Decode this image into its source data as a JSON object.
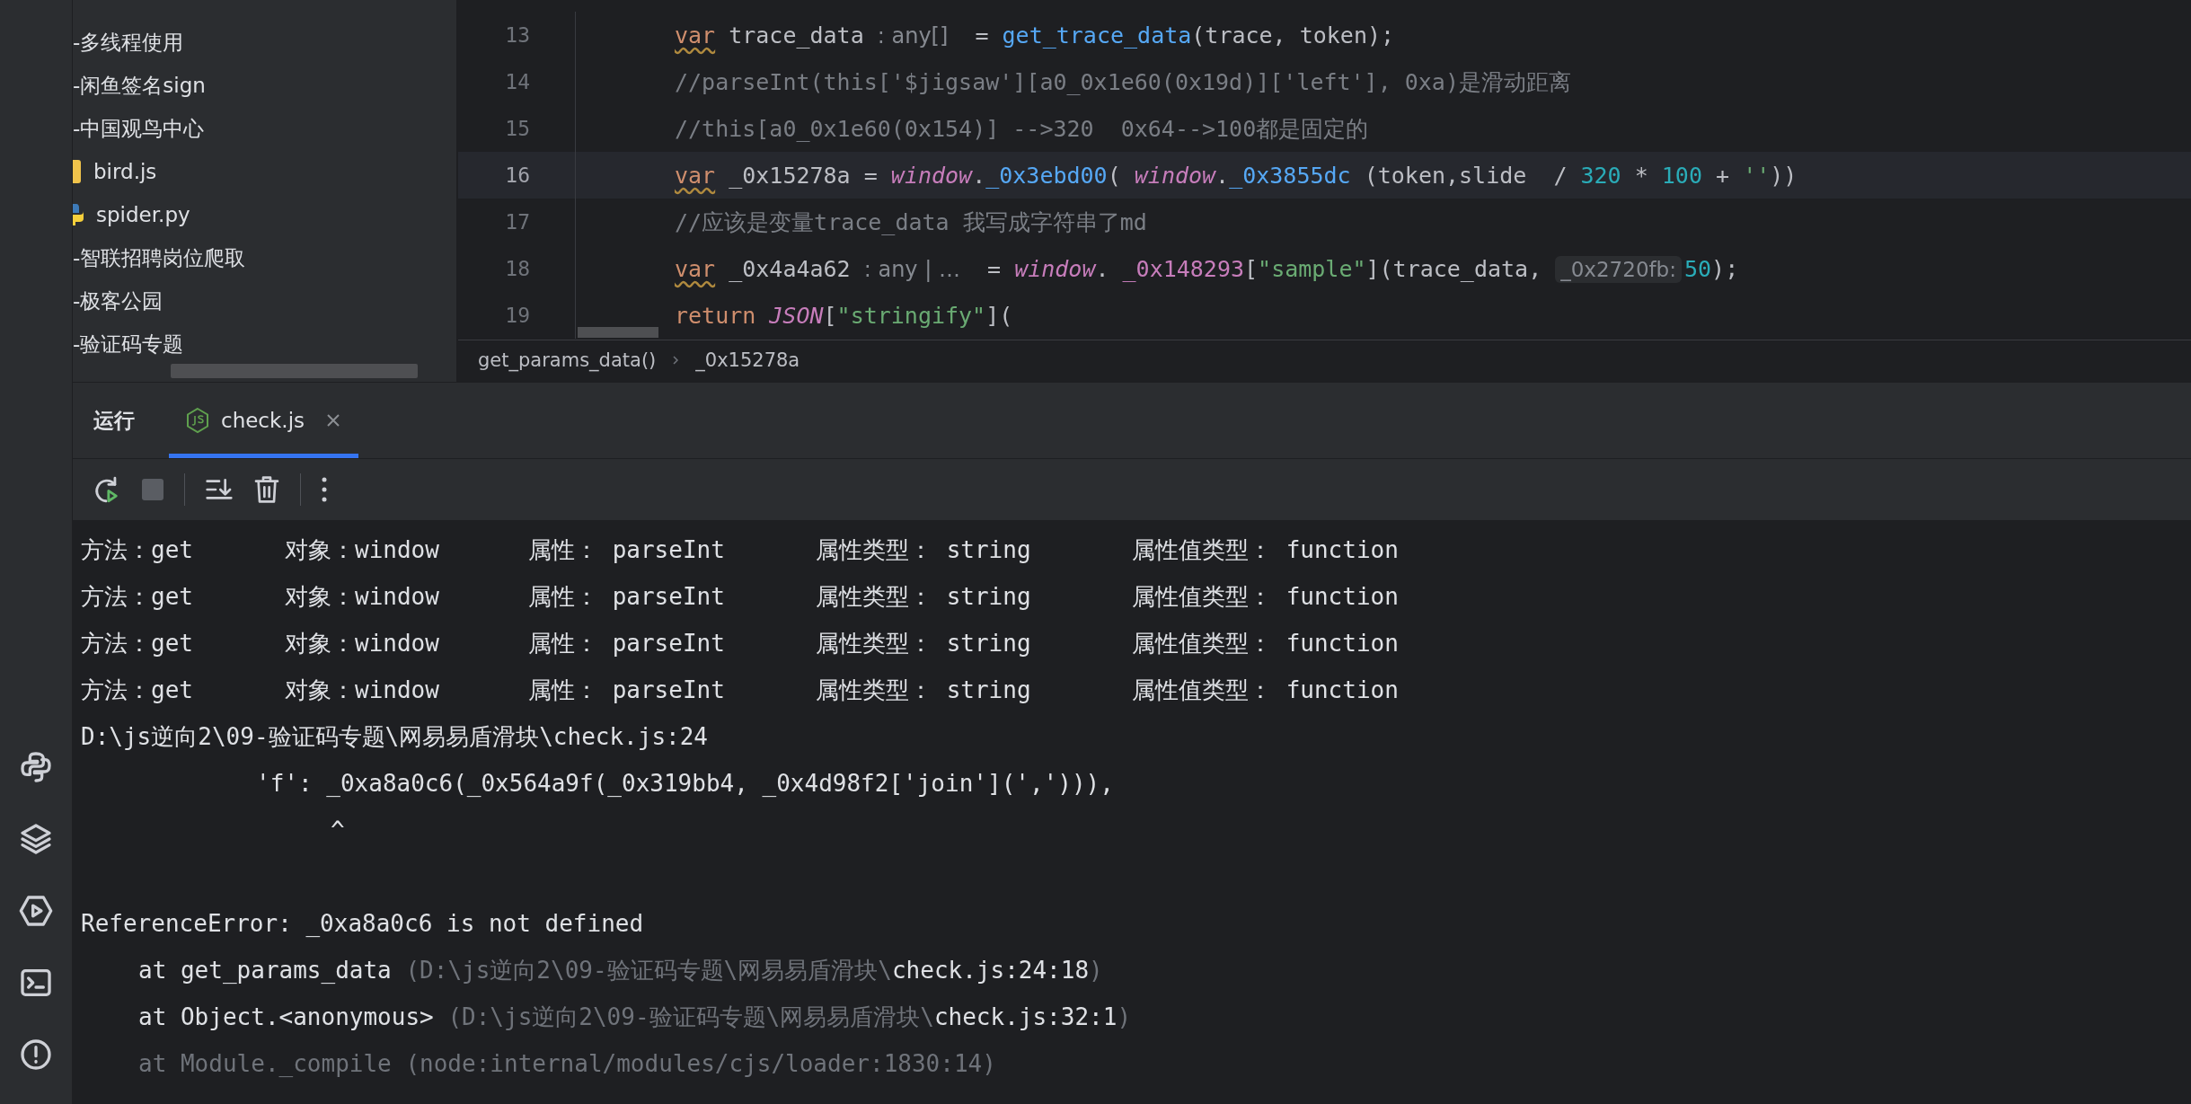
{
  "project_tree": {
    "items": [
      {
        "label": "-多线程使用",
        "kind": "folder"
      },
      {
        "label": "-闲鱼签名sign",
        "kind": "folder"
      },
      {
        "label": "-中国观鸟中心",
        "kind": "folder"
      },
      {
        "label": "bird.js",
        "kind": "js"
      },
      {
        "label": "spider.py",
        "kind": "python"
      },
      {
        "label": "-智联招聘岗位爬取",
        "kind": "folder"
      },
      {
        "label": "-极客公园",
        "kind": "folder"
      },
      {
        "label": "-验证码专题",
        "kind": "folder"
      }
    ]
  },
  "editor": {
    "lines": [
      {
        "number": "13",
        "current": false,
        "tokens": [
          {
            "text": "var",
            "kind": "keyword_warning"
          },
          {
            "text": " trace_data ",
            "kind": "plain"
          },
          {
            "text": ": any[]",
            "kind": "hint"
          },
          {
            "text": "  = ",
            "kind": "plain"
          },
          {
            "text": "get_trace_data",
            "kind": "function"
          },
          {
            "text": "(trace, token);",
            "kind": "plain"
          }
        ]
      },
      {
        "number": "14",
        "current": false,
        "tokens": [
          {
            "text": "//parseInt(this['$jigsaw'][a0_0x1e60(0x19d)]['left'], 0xa)是滑动距离",
            "kind": "comment"
          }
        ]
      },
      {
        "number": "15",
        "current": false,
        "tokens": [
          {
            "text": "//this[a0_0x1e60(0x154)] -->320  0x64-->100都是固定的",
            "kind": "comment"
          }
        ]
      },
      {
        "number": "16",
        "current": true,
        "tokens": [
          {
            "text": "var",
            "kind": "keyword_warning"
          },
          {
            "text": " _0x15278a = ",
            "kind": "plain"
          },
          {
            "text": "window",
            "kind": "global"
          },
          {
            "text": ".",
            "kind": "plain"
          },
          {
            "text": "_0x3ebd00",
            "kind": "function"
          },
          {
            "text": "( ",
            "kind": "plain"
          },
          {
            "text": "window",
            "kind": "global"
          },
          {
            "text": ".",
            "kind": "plain"
          },
          {
            "text": "_0x3855dc",
            "kind": "function"
          },
          {
            "text": " (token,slide  / ",
            "kind": "plain"
          },
          {
            "text": "320",
            "kind": "number"
          },
          {
            "text": " * ",
            "kind": "plain"
          },
          {
            "text": "100",
            "kind": "number"
          },
          {
            "text": " + ",
            "kind": "plain"
          },
          {
            "text": "''",
            "kind": "string"
          },
          {
            "text": "))",
            "kind": "plain"
          }
        ]
      },
      {
        "number": "17",
        "current": false,
        "tokens": [
          {
            "text": "//应该是变量trace_data 我写成字符串了md",
            "kind": "comment"
          }
        ]
      },
      {
        "number": "18",
        "current": false,
        "tokens": [
          {
            "text": "var",
            "kind": "keyword_warning"
          },
          {
            "text": " _0x4a4a62 ",
            "kind": "plain"
          },
          {
            "text": ": any | …",
            "kind": "hint"
          },
          {
            "text": "  = ",
            "kind": "plain"
          },
          {
            "text": "window",
            "kind": "global"
          },
          {
            "text": ". ",
            "kind": "plain"
          },
          {
            "text": "_0x148293",
            "kind": "property"
          },
          {
            "text": "[",
            "kind": "plain"
          },
          {
            "text": "\"sample\"",
            "kind": "string"
          },
          {
            "text": "](trace_data, ",
            "kind": "plain"
          },
          {
            "text": "_0x2720fb:",
            "kind": "parameter_hint"
          },
          {
            "text": "50",
            "kind": "number"
          },
          {
            "text": ");",
            "kind": "plain"
          }
        ]
      },
      {
        "number": "19",
        "current": false,
        "tokens": [
          {
            "text": "return",
            "kind": "keyword"
          },
          {
            "text": "JSON",
            "kind": "global"
          },
          {
            "text": "[",
            "kind": "plain"
          },
          {
            "text": "\"stringify\"",
            "kind": "string"
          },
          {
            "text": "](",
            "kind": "plain"
          }
        ]
      }
    ],
    "breadcrumbs": [
      "get_params_data()",
      "_0x15278a"
    ]
  },
  "run_panel": {
    "title": "运行",
    "tabs": [
      {
        "label": "check.js",
        "selected": true
      }
    ]
  },
  "console": {
    "lines": [
      {
        "kind": "log",
        "cells": [
          "方法：get",
          "对象：window",
          "属性： parseInt",
          "属性类型： string",
          "属性值类型： function"
        ]
      },
      {
        "kind": "log",
        "cells": [
          "方法：get",
          "对象：window",
          "属性： parseInt",
          "属性类型： string",
          "属性值类型： function"
        ]
      },
      {
        "kind": "log",
        "cells": [
          "方法：get",
          "对象：window",
          "属性： parseInt",
          "属性类型： string",
          "属性值类型： function"
        ]
      },
      {
        "kind": "log",
        "cells": [
          "方法：get",
          "对象：window",
          "属性： parseInt",
          "属性类型： string",
          "属性值类型： function"
        ]
      },
      {
        "kind": "text",
        "segments": [
          {
            "text": "D:\\js逆向2\\09-验证码专题\\网易易盾滑块\\check.js:24",
            "dim": false
          }
        ]
      },
      {
        "kind": "source",
        "segments": [
          {
            "text": "'f': _0xa8a0c6(_0x564a9f(_0x319bb4, _0x4d98f2['join'](','))),",
            "dim": false
          }
        ]
      },
      {
        "kind": "caret",
        "segments": [
          {
            "text": "^",
            "dim": false
          }
        ]
      },
      {
        "kind": "blank"
      },
      {
        "kind": "text",
        "segments": [
          {
            "text": "ReferenceError: _0xa8a0c6 is not defined",
            "dim": false
          }
        ]
      },
      {
        "kind": "stack",
        "segments": [
          {
            "text": "at get_params_data ",
            "dim": false
          },
          {
            "text": "(D:\\js逆向2\\09-验证码专题\\网易易盾滑块\\",
            "dim": true
          },
          {
            "text": "check.js:24:18",
            "dim": false
          },
          {
            "text": ")",
            "dim": true
          }
        ]
      },
      {
        "kind": "stack",
        "segments": [
          {
            "text": "at Object.<anonymous> ",
            "dim": false
          },
          {
            "text": "(D:\\js逆向2\\09-验证码专题\\网易易盾滑块\\",
            "dim": true
          },
          {
            "text": "check.js:32:1",
            "dim": false
          },
          {
            "text": ")",
            "dim": true
          }
        ]
      },
      {
        "kind": "stack",
        "segments": [
          {
            "text": "at Module._compile (node:internal/modules/cjs/loader:1830:14)",
            "dim": true
          }
        ]
      }
    ]
  }
}
